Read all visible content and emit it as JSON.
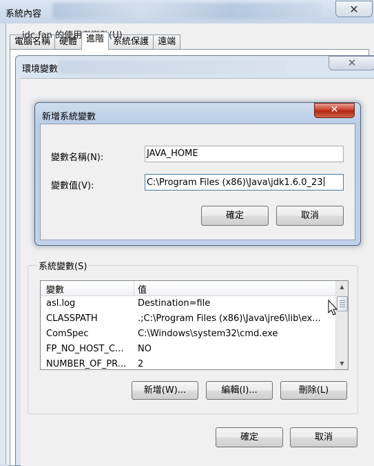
{
  "system_properties": {
    "title": "系統內容",
    "close_glyph": "✕",
    "tabs": [
      {
        "label": "電腦名稱"
      },
      {
        "label": "硬體"
      },
      {
        "label": "進階"
      },
      {
        "label": "系統保護"
      },
      {
        "label": "遠端"
      }
    ],
    "ok_label": "確定",
    "cancel_label": "取消"
  },
  "env_dialog": {
    "title": "環境變數",
    "close_glyph": "✕",
    "user_vars_label": "idc fan 的使用者變數(U)",
    "system_vars_label": "系統變數(S)",
    "columns": {
      "name": "變數",
      "value": "值"
    },
    "rows": [
      {
        "name": "asl.log",
        "value": "Destination=file"
      },
      {
        "name": "CLASSPATH",
        "value": ".;C:\\Program Files (x86)\\Java\\jre6\\lib\\ex..."
      },
      {
        "name": "ComSpec",
        "value": "C:\\Windows\\system32\\cmd.exe"
      },
      {
        "name": "FP_NO_HOST_C...",
        "value": "NO"
      },
      {
        "name": "NUMBER_OF_PR...",
        "value": "2"
      }
    ],
    "new_button": "新增(W)...",
    "edit_button": "編輯(I)...",
    "delete_button": "刪除(L)",
    "ok_label": "確定",
    "cancel_label": "取消"
  },
  "new_var_dialog": {
    "title": "新增系統變數",
    "close_glyph": "✕",
    "name_label": "變數名稱(N):",
    "name_value": "JAVA_HOME",
    "value_label": "變數值(V):",
    "value_value": "C:\\Program Files (x86)\\Java\\jdk1.6.0_23",
    "ok_label": "確定",
    "cancel_label": "取消"
  },
  "colors": {
    "title_bar": "#c7d6e8",
    "close_red": "#c8452f",
    "dialog_bg": "#f0f0f0"
  }
}
